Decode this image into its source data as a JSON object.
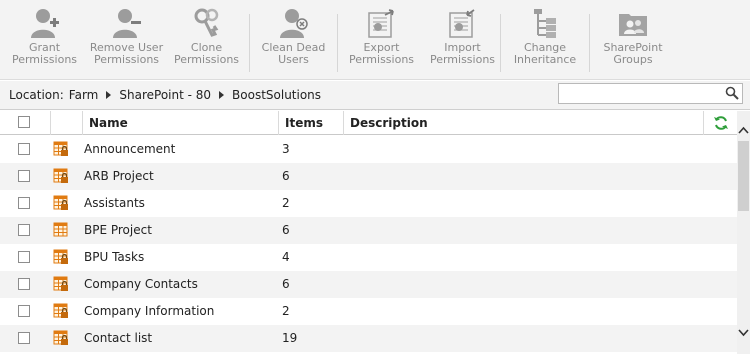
{
  "ribbon": {
    "buttons": [
      {
        "label": "Grant\nPermissions",
        "icon": "user-add-icon"
      },
      {
        "label": "Remove User\nPermissions",
        "icon": "user-remove-icon"
      },
      {
        "label": "Clone\nPermissions",
        "icon": "keys-icon"
      },
      {
        "label": "Clean Dead\nUsers",
        "icon": "user-delete-icon"
      },
      {
        "label": "Export\nPermissions",
        "icon": "export-icon"
      },
      {
        "label": "Import\nPermissions",
        "icon": "import-icon"
      },
      {
        "label": "Change\nInheritance",
        "icon": "inheritance-icon"
      },
      {
        "label": "SharePoint\nGroups",
        "icon": "groups-icon"
      }
    ]
  },
  "location": {
    "label": "Location:",
    "crumbs": [
      "Farm",
      "SharePoint - 80",
      "BoostSolutions"
    ]
  },
  "search": {
    "placeholder": ""
  },
  "table": {
    "headers": {
      "name": "Name",
      "items": "Items",
      "description": "Description"
    },
    "rows": [
      {
        "name": "Announcement",
        "items": "3",
        "description": "",
        "icon": "list-locked-icon"
      },
      {
        "name": "ARB Project",
        "items": "6",
        "description": "",
        "icon": "list-locked-icon"
      },
      {
        "name": "Assistants",
        "items": "2",
        "description": "",
        "icon": "list-locked-icon"
      },
      {
        "name": "BPE Project",
        "items": "6",
        "description": "",
        "icon": "list-icon"
      },
      {
        "name": "BPU Tasks",
        "items": "4",
        "description": "",
        "icon": "list-locked-icon"
      },
      {
        "name": "Company Contacts",
        "items": "6",
        "description": "",
        "icon": "list-locked-icon"
      },
      {
        "name": "Company Information",
        "items": "2",
        "description": "",
        "icon": "list-locked-icon"
      },
      {
        "name": "Contact list",
        "items": "19",
        "description": "",
        "icon": "list-locked-icon"
      }
    ]
  },
  "colors": {
    "icon_gray": "#9c9c9c",
    "icon_orange": "#e07b12",
    "refresh_green": "#2e9e3a",
    "row_alt": "#f3f3f3"
  }
}
